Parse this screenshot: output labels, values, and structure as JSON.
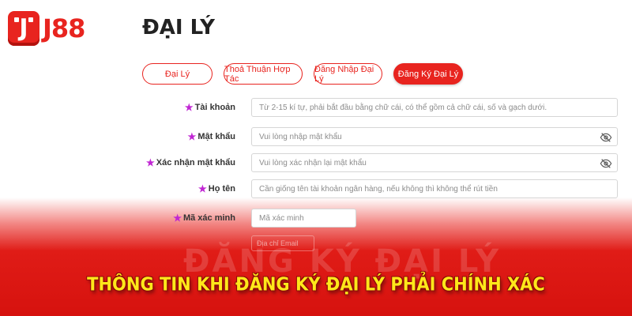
{
  "brand": {
    "logo_text": "J88",
    "logo_glyph": "J",
    "accent": "#e8241f",
    "caption_color": "#ffe81a",
    "required_star_color": "#c026d3"
  },
  "page": {
    "title": "ĐẠI LÝ"
  },
  "tabs": [
    {
      "label": "Đại Lý",
      "active": false
    },
    {
      "label": "Thoả Thuận Hợp Tác",
      "active": false
    },
    {
      "label": "Đăng Nhập Đại Lý",
      "active": false
    },
    {
      "label": "Đăng Ký Đại Lý",
      "active": true
    }
  ],
  "form": {
    "required_mark": "★",
    "fields": [
      {
        "label": "Tài khoản",
        "placeholder": "Từ 2-15 kí tự, phải bắt đầu bằng chữ cái, có thể  gồm cả chữ cái, số và gạch dưới.",
        "icon": ""
      },
      {
        "label": "Mật khẩu",
        "placeholder": "Vui lòng nhập mật khẩu",
        "icon": "eye-off-icon"
      },
      {
        "label": "Xác nhận mật khẩu",
        "placeholder": "Vui lòng xác nhận lại mật khẩu",
        "icon": "eye-off-icon"
      },
      {
        "label": "Họ tên",
        "placeholder": "Cần giống tên tài khoản ngân hàng, nếu không thì không thể rút tiền",
        "icon": ""
      },
      {
        "label": "Mã xác minh",
        "placeholder": "Mã xác minh",
        "icon": ""
      }
    ],
    "faded_field_placeholder": "Địa chỉ Email"
  },
  "banner": {
    "watermark": "ĐĂNG KÝ ĐẠI LÝ",
    "caption": "THÔNG TIN KHI ĐĂNG KÝ ĐẠI LÝ PHẢI CHÍNH XÁC"
  }
}
